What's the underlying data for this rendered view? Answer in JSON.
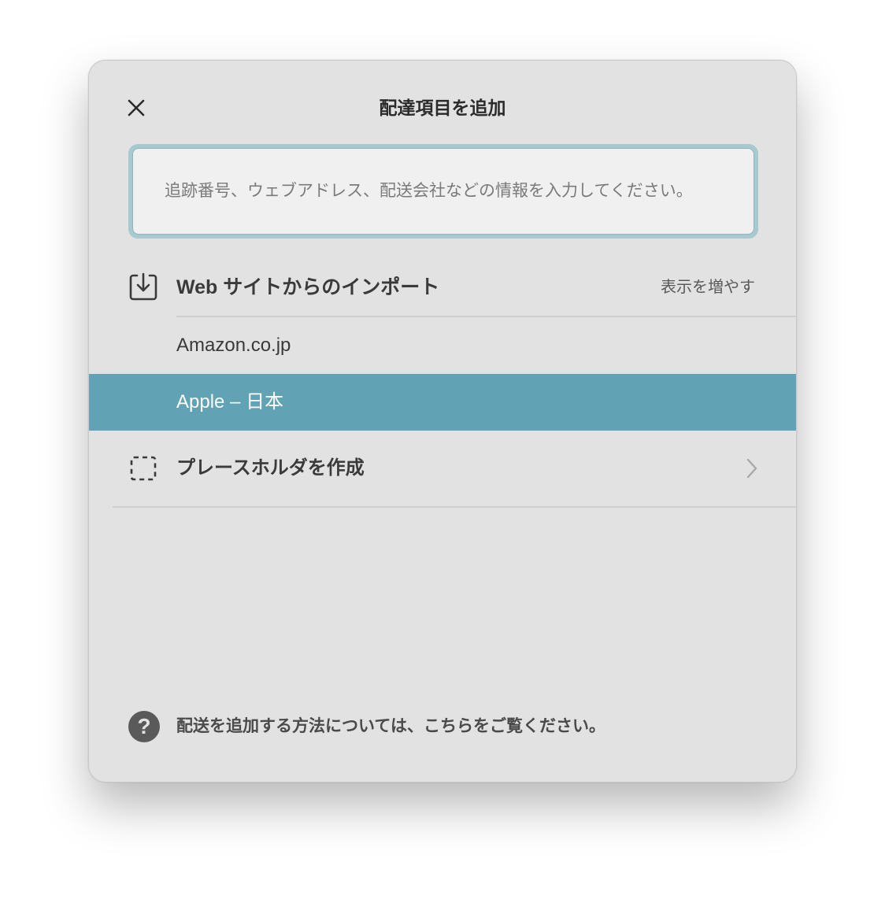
{
  "dialog": {
    "title": "配達項目を追加",
    "close_icon": "close-icon"
  },
  "search": {
    "placeholder": "追跡番号、ウェブアドレス、配送会社などの情報を入力してください。",
    "value": ""
  },
  "import_section": {
    "icon": "import-icon",
    "label": "Web サイトからのインポート",
    "show_more": "表示を増やす",
    "items": [
      {
        "label": "Amazon.co.jp",
        "selected": false
      },
      {
        "label": "Apple – 日本",
        "selected": true
      }
    ]
  },
  "placeholder_row": {
    "icon": "dashed-square-icon",
    "label": "プレースホルダを作成",
    "chevron": "chevron-right-icon"
  },
  "help": {
    "icon": "question-circle-icon",
    "glyph": "?",
    "text": "配送を追加する方法については、こちらをご覧ください。"
  },
  "colors": {
    "accent": "#62a2b5",
    "background": "#e2e2e2",
    "input_focus_ring": "#a8c9cf"
  }
}
